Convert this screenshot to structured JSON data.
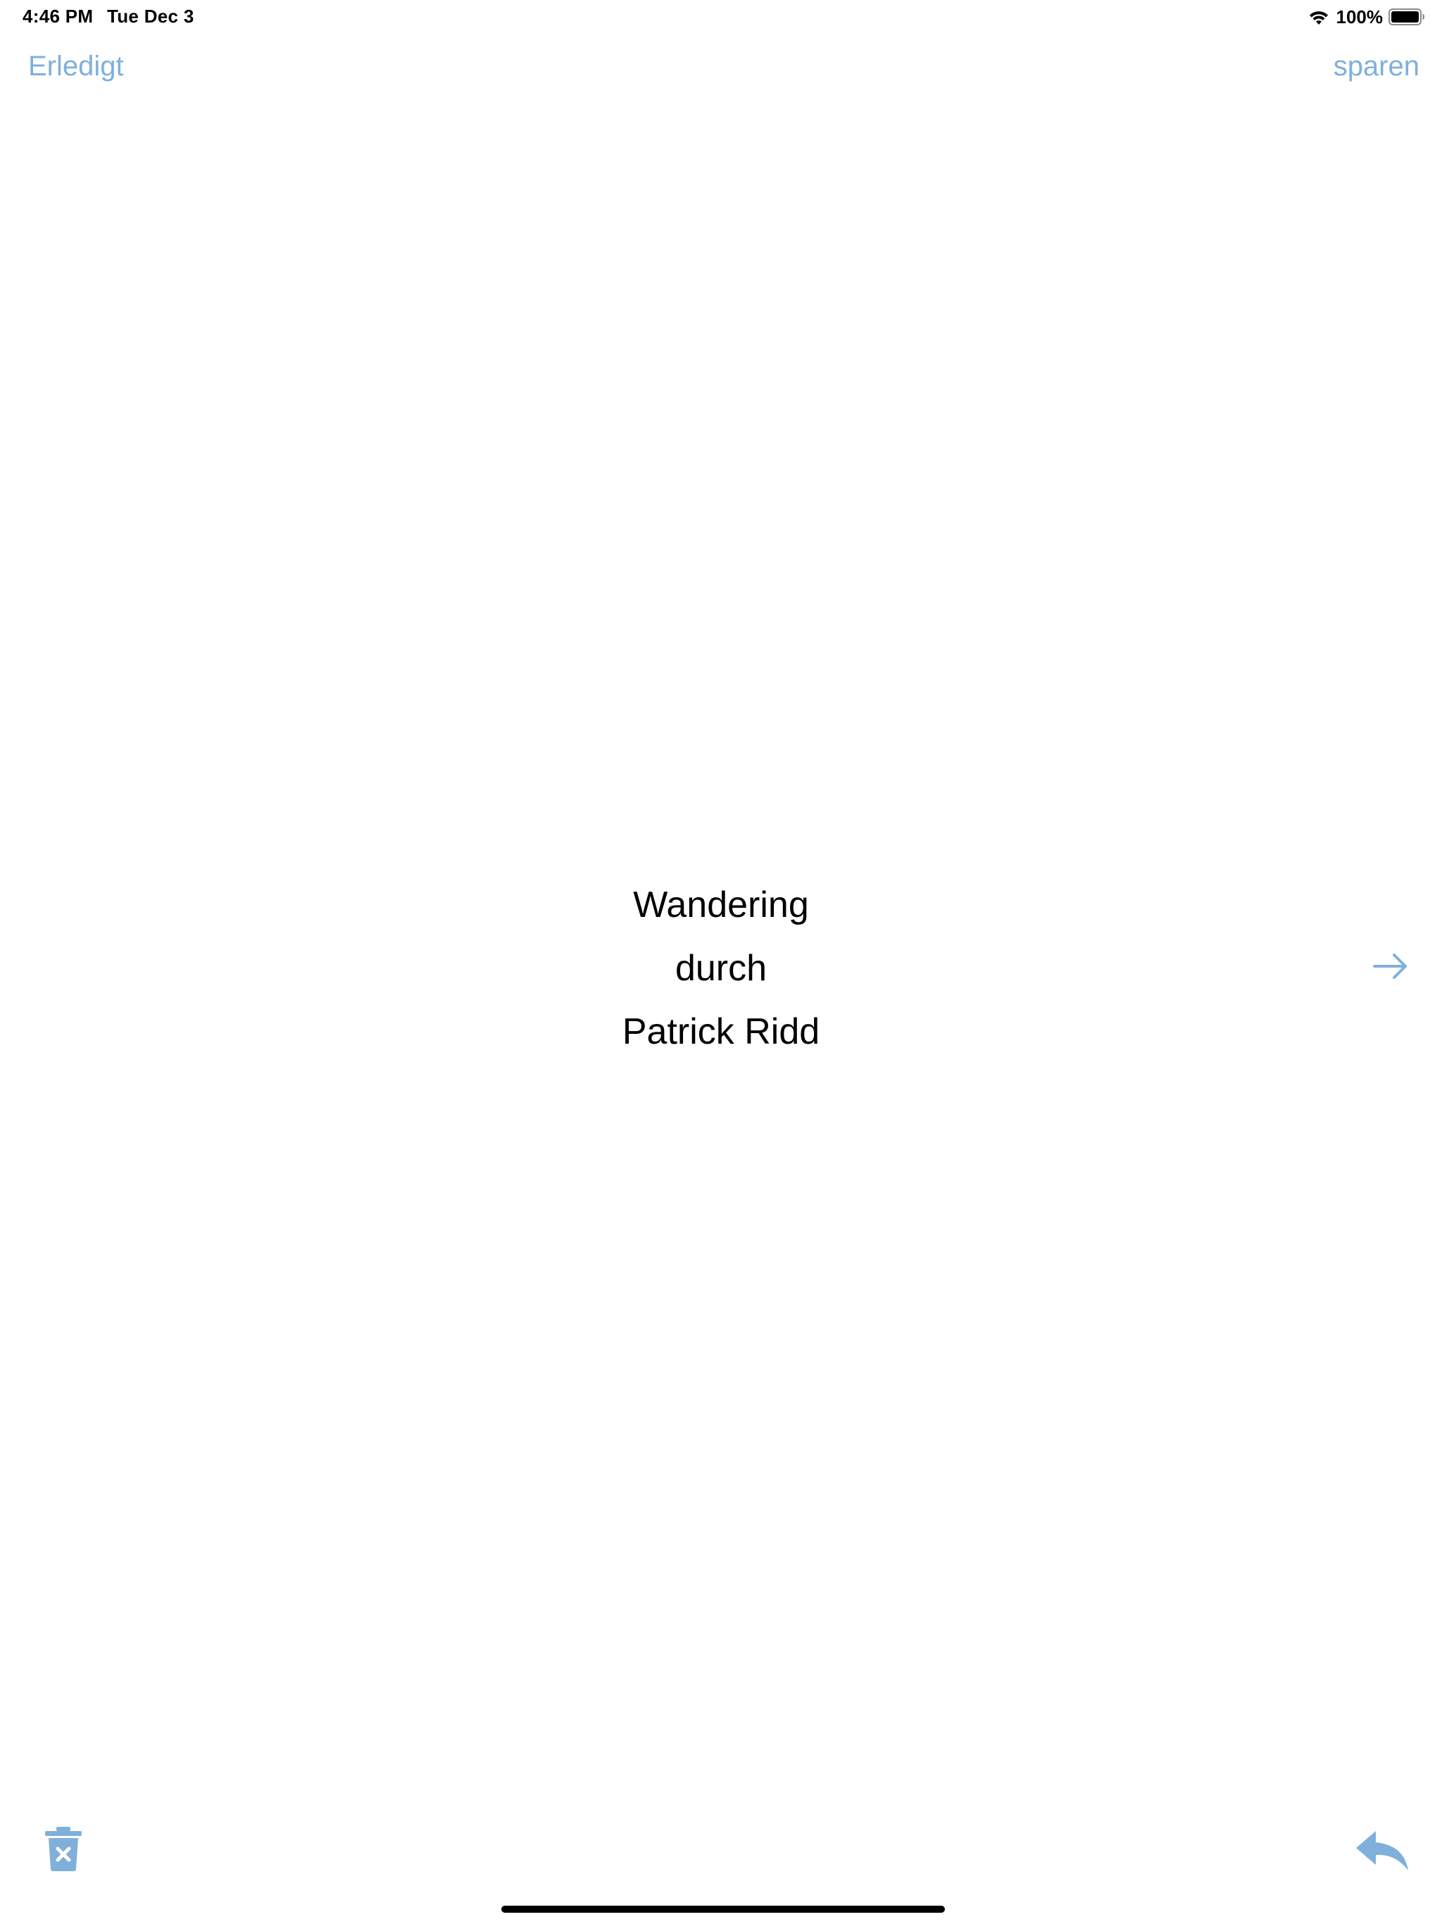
{
  "status_bar": {
    "time": "4:46 PM",
    "date": "Tue Dec 3",
    "battery_percent": "100%",
    "icons": [
      "wifi-icon",
      "battery-icon"
    ]
  },
  "nav": {
    "left_label": "Erledigt",
    "right_label": "sparen"
  },
  "content": {
    "lines": [
      "Wandering",
      "durch",
      "Patrick Ridd"
    ]
  },
  "toolbar": {
    "icons": [
      "trash-icon",
      "reply-icon",
      "arrow-right-icon"
    ]
  },
  "colors": {
    "accent": "#7fb0dc",
    "text": "#000000",
    "background": "#ffffff"
  }
}
